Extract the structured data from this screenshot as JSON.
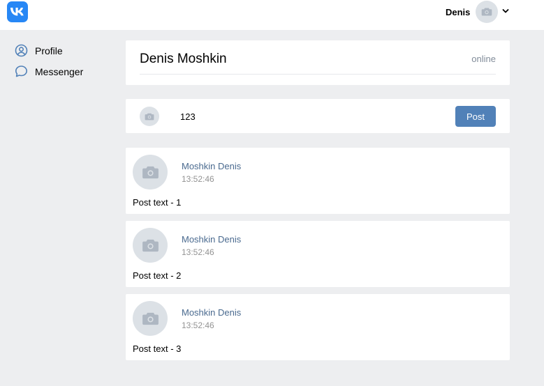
{
  "header": {
    "logo_icon": "vk-logo-icon",
    "user_name": "Denis",
    "avatar_icon": "camera-icon",
    "menu_icon": "chevron-down-icon",
    "accent_color": "#2787f5"
  },
  "sidebar": {
    "items": [
      {
        "label": "Profile",
        "icon": "user-circle-icon"
      },
      {
        "label": "Messenger",
        "icon": "speech-bubble-icon"
      }
    ]
  },
  "profile": {
    "name": "Denis Moshkin",
    "status": "online"
  },
  "compose": {
    "avatar_icon": "camera-icon",
    "input_value": "123",
    "post_button_label": "Post",
    "button_color": "#5181b8"
  },
  "posts": [
    {
      "author": "Moshkin Denis",
      "time": "13:52:46",
      "text": "Post text - 1"
    },
    {
      "author": "Moshkin Denis",
      "time": "13:52:46",
      "text": "Post text - 2"
    },
    {
      "author": "Moshkin Denis",
      "time": "13:52:46",
      "text": "Post text - 3"
    }
  ]
}
